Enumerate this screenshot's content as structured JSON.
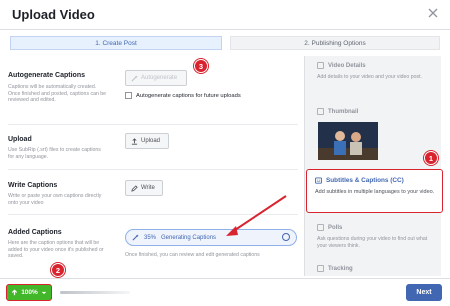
{
  "window": {
    "title": "Upload Video"
  },
  "steps": {
    "step1": "1. Create Post",
    "step2": "2. Publishing Options"
  },
  "autogenerate": {
    "label": "Autogenerate Captions",
    "desc": "Captions will be automatically created. Once finished and posted, captions can be reviewed and edited.",
    "button": "Autogenerate",
    "checkbox_label": "Autogenerate captions for future uploads"
  },
  "upload": {
    "label": "Upload",
    "desc": "Use SubRip (.srt) files to create captions for any language.",
    "button": "Upload"
  },
  "write": {
    "label": "Write Captions",
    "desc": "Write or paste your own captions directly onto your video",
    "button": "Write"
  },
  "added": {
    "label": "Added Captions",
    "desc": "Here are the caption options that will be added to your video once it's published or saved.",
    "progress_percent": "35%",
    "progress_text": "Generating Captions",
    "progress_value": 0.35,
    "hint": "Once finished, you can review and edit generated captions"
  },
  "sidebar": {
    "video_details": {
      "title": "Video Details",
      "desc": "Add details to your video and your video post."
    },
    "thumbnail": {
      "title": "Thumbnail"
    },
    "subtitles": {
      "title": "Subtitles & Captions (CC)",
      "desc": "Add subtitles in multiple languages to your video."
    },
    "polls": {
      "title": "Polls",
      "desc": "Ask questions during your video to find out what your viewers think."
    },
    "tracking": {
      "title": "Tracking"
    }
  },
  "footer": {
    "percent_button": "100%",
    "next_button": "Next"
  },
  "markers": {
    "m1": "1",
    "m2": "2",
    "m3": "3"
  },
  "colors": {
    "accent": "#4267b2",
    "annotation": "#d9232e",
    "success": "#42b72a"
  }
}
